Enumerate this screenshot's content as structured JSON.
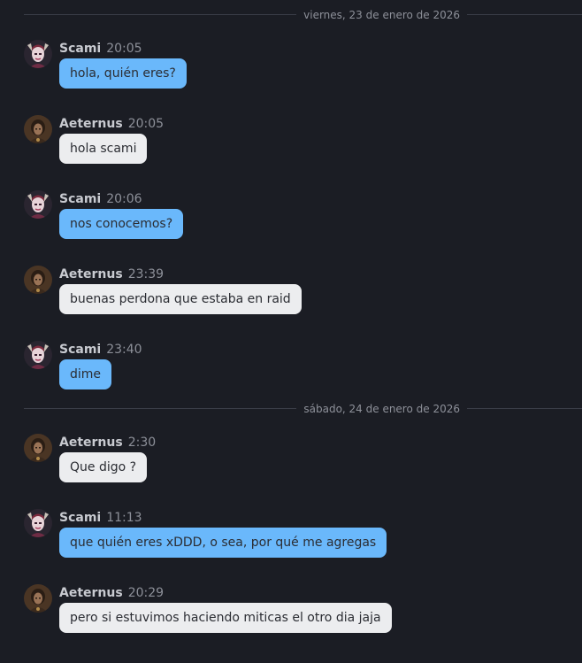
{
  "colors": {
    "background": "#1b1d24",
    "outgoing_bubble": "#6ab8fb",
    "incoming_bubble": "#ecedef",
    "divider_line": "#3a3d47",
    "muted_text": "#8d9099"
  },
  "dividers": [
    {
      "label": "viernes, 23 de enero de 2026"
    },
    {
      "label": "sábado, 24 de enero de 2026"
    }
  ],
  "messages": [
    {
      "author": "Scami",
      "time": "20:05",
      "text": "hola, quién eres?",
      "direction": "out",
      "avatar_icon": "scami-avatar"
    },
    {
      "author": "Aeternus",
      "time": "20:05",
      "text": "hola scami",
      "direction": "in",
      "avatar_icon": "aeternus-avatar"
    },
    {
      "author": "Scami",
      "time": "20:06",
      "text": "nos conocemos?",
      "direction": "out",
      "avatar_icon": "scami-avatar"
    },
    {
      "author": "Aeternus",
      "time": "23:39",
      "text": "buenas perdona que estaba en raid",
      "direction": "in",
      "avatar_icon": "aeternus-avatar"
    },
    {
      "author": "Scami",
      "time": "23:40",
      "text": "dime",
      "direction": "out",
      "avatar_icon": "scami-avatar"
    },
    {
      "author": "Aeternus",
      "time": "2:30",
      "text": "Que digo ?",
      "direction": "in",
      "avatar_icon": "aeternus-avatar"
    },
    {
      "author": "Scami",
      "time": "11:13",
      "text": "que quién eres xDDD, o sea, por qué me agregas",
      "direction": "out",
      "avatar_icon": "scami-avatar"
    },
    {
      "author": "Aeternus",
      "time": "20:29",
      "text": "pero si estuvimos haciendo miticas el otro dia jaja",
      "direction": "in",
      "avatar_icon": "aeternus-avatar"
    }
  ]
}
